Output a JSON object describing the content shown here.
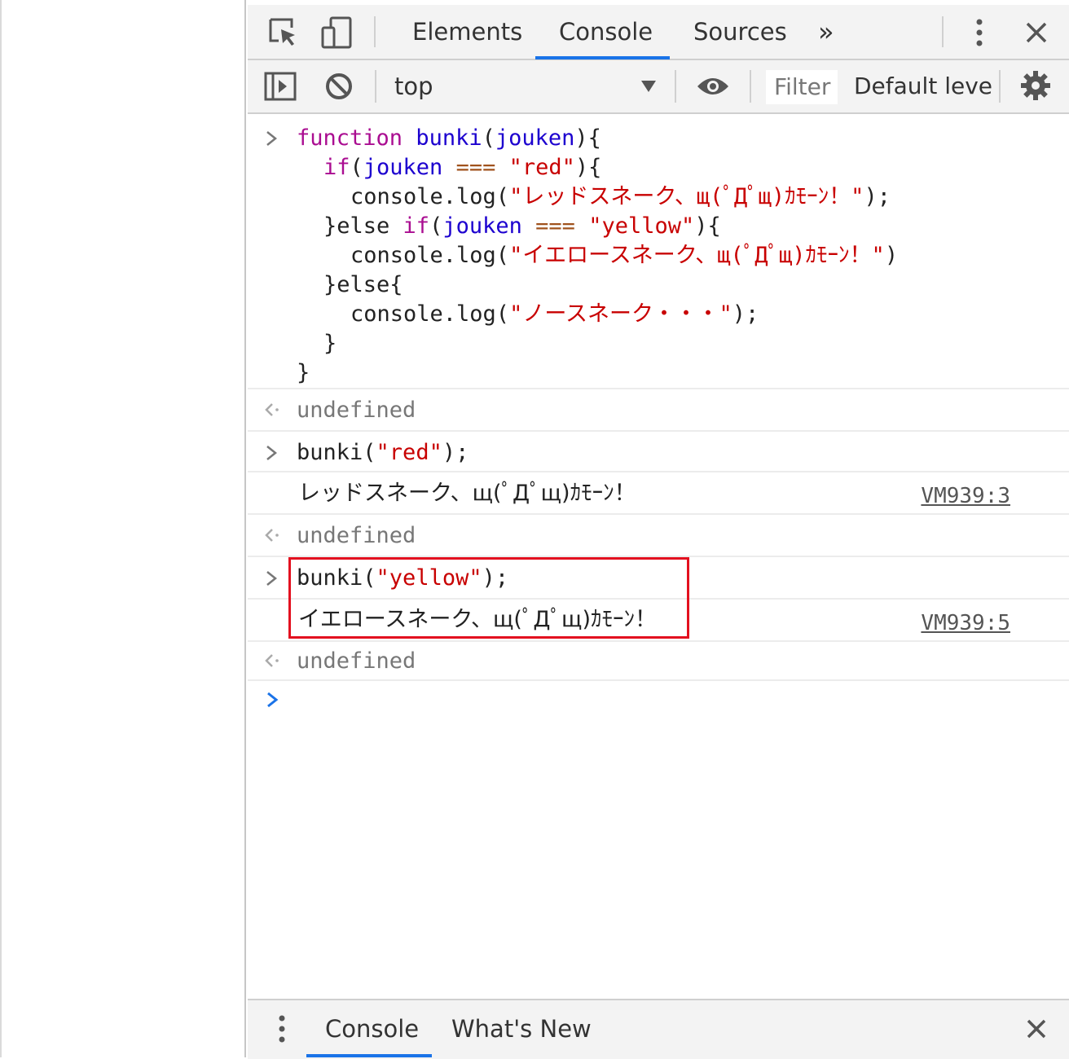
{
  "tabs": {
    "elements": "Elements",
    "console": "Console",
    "sources": "Sources",
    "more": "»"
  },
  "toolbar": {
    "context": "top",
    "filter_placeholder": "Filter",
    "levels": "Default leve"
  },
  "console": {
    "function_lines": [
      [
        "function",
        "bunki",
        "(",
        "jouken",
        "){"
      ],
      [
        "if",
        "(",
        "jouken",
        "===",
        "\"red\"",
        "){"
      ],
      [
        "console.log(",
        "\"レッドスネーク、щ(ﾟДﾟщ)ｶﾓｰﾝ！\"",
        ");"
      ],
      [
        "}else ",
        "if",
        "(",
        "jouken",
        "===",
        "\"yellow\"",
        "){"
      ],
      [
        "console.log(",
        "\"イエロースネーク、щ(ﾟДﾟщ)ｶﾓｰﾝ！\"",
        ")"
      ],
      [
        "}else{"
      ],
      [
        "console.log(",
        "\"ノースネーク・・・\"",
        ");"
      ],
      [
        "}"
      ],
      [
        "}"
      ]
    ],
    "result_undefined": "undefined",
    "call_red_prefix": "bunki(",
    "call_red_arg": "\"red\"",
    "call_suffix": ");",
    "log_red": "レッドスネーク、щ(ﾟДﾟщ)ｶﾓｰﾝ！",
    "log_red_source": "VM939:3",
    "call_yellow_prefix": "bunki(",
    "call_yellow_arg": "\"yellow\"",
    "log_yellow": "イエロースネーク、щ(ﾟДﾟщ)ｶﾓｰﾝ！",
    "log_yellow_source": "VM939:5"
  },
  "drawer": {
    "console": "Console",
    "whats_new": "What's New"
  },
  "colors": {
    "accent": "#1a73e8",
    "highlight": "#e3101f",
    "string": "#c80000",
    "keyword": "#aa0d91"
  }
}
